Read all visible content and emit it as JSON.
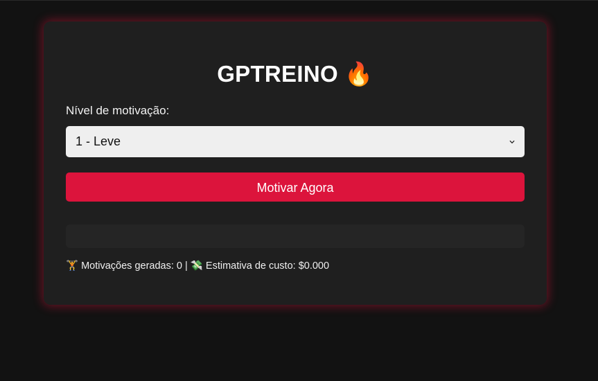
{
  "app": {
    "title": "GPTREINO 🔥"
  },
  "form": {
    "motivation_label": "Nível de motivação:",
    "motivation_selected": "1 - Leve",
    "submit_label": "Motivar Agora"
  },
  "output": {
    "text": ""
  },
  "stats": {
    "motivations_icon": "🏋",
    "motivations_text": "Motivações geradas: 0",
    "separator": "|",
    "cost_icon": "💸",
    "cost_text": "Estimativa de custo: $0.000"
  },
  "colors": {
    "background": "#121212",
    "card": "#1f1f1f",
    "accent": "#dc143c",
    "select_bg": "#efefef"
  },
  "icons": {
    "select_arrow": "chevron-down-icon"
  }
}
